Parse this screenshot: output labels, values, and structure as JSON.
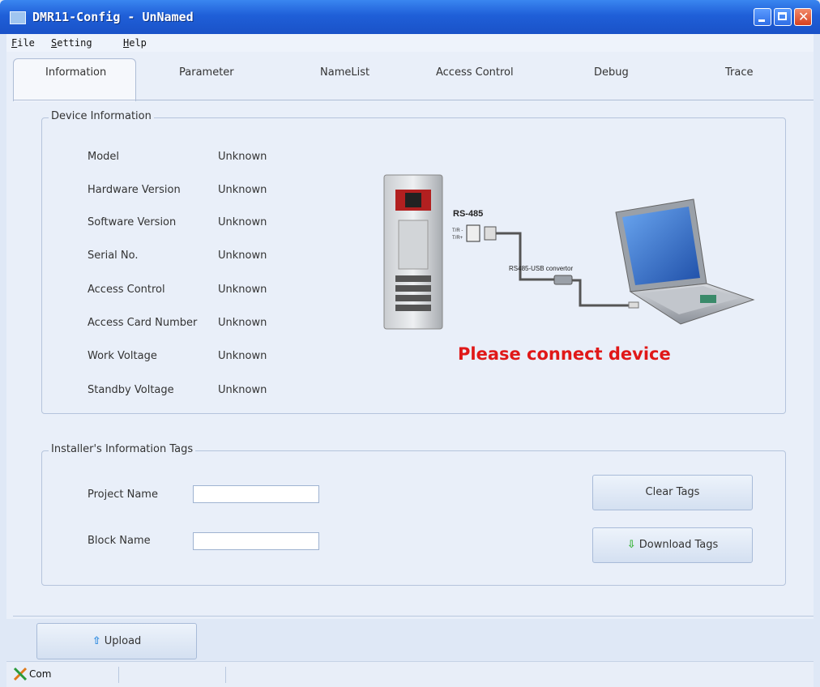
{
  "window": {
    "title": "DMR11-Config - UnNamed"
  },
  "menu": {
    "items": [
      {
        "accel": "F",
        "rest": "ile"
      },
      {
        "accel": "S",
        "rest": "etting"
      },
      {
        "accel": "H",
        "rest": "elp"
      }
    ]
  },
  "tabs": [
    "Information",
    "Parameter",
    "NameList",
    "Access Control",
    "Debug",
    "Trace"
  ],
  "device_info": {
    "title": "Device Information",
    "rows": [
      {
        "label": "Model",
        "value": "Unknown"
      },
      {
        "label": "Hardware Version",
        "value": "Unknown"
      },
      {
        "label": "Software Version",
        "value": "Unknown"
      },
      {
        "label": "Serial No.",
        "value": "Unknown"
      },
      {
        "label": "Access Control",
        "value": "Unknown"
      },
      {
        "label": "Access Card Number",
        "value": "Unknown"
      },
      {
        "label": "Work Voltage",
        "value": "Unknown"
      },
      {
        "label": "Standby Voltage",
        "value": "Unknown"
      }
    ]
  },
  "diagram": {
    "rs485_label": "RS-485",
    "tr_minus": "T/R -",
    "tr_plus": "T/R+",
    "convertor_label": "RS485-USB convertor",
    "message": "Please connect device"
  },
  "tags": {
    "title": "Installer's Information Tags",
    "project_label": "Project Name",
    "project_value": "",
    "block_label": "Block Name",
    "block_value": "",
    "clear_button": "Clear Tags",
    "download_button": "Download Tags"
  },
  "upload_button": "Upload",
  "status": {
    "com_label": "Com"
  },
  "colors": {
    "title_bar": "#1f5fd8",
    "message": "#e01818",
    "arrow": "#3cb43c",
    "upload_arrow": "#2f8be0"
  }
}
